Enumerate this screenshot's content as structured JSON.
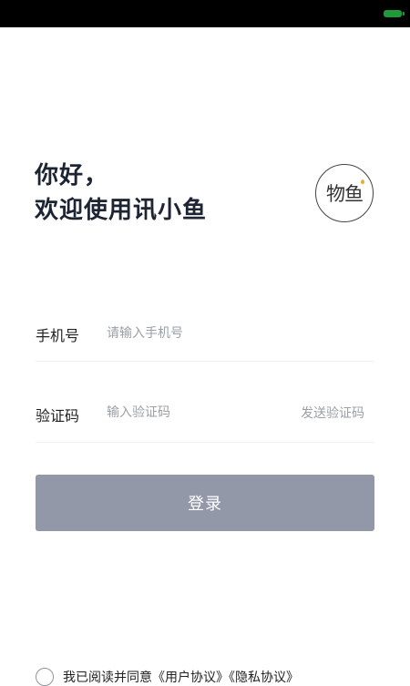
{
  "greeting": {
    "line1": "你好，",
    "line2": "欢迎使用讯小鱼"
  },
  "logo": {
    "text": "物鱼"
  },
  "phone": {
    "label": "手机号",
    "placeholder": "请输入手机号"
  },
  "code": {
    "label": "验证码",
    "placeholder": "输入验证码",
    "send_label": "发送验证码"
  },
  "login_button": "登录",
  "agreement": {
    "text": "我已阅读并同意《用户协议》《隐私协议》"
  }
}
